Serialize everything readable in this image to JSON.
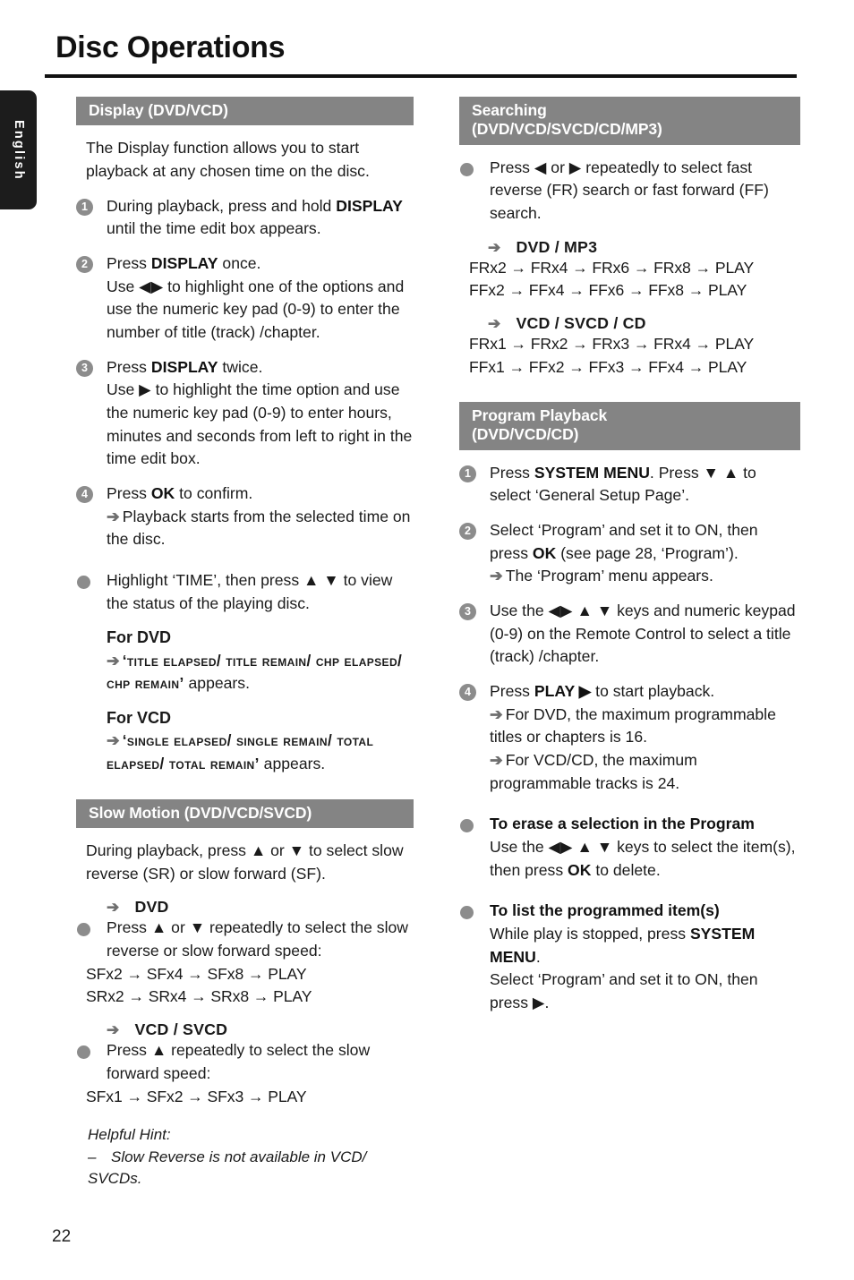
{
  "page": {
    "title": "Disc Operations",
    "number": "22",
    "language_tab": "English",
    "bar_color": "#848484",
    "badge_color": "#8c8c8c"
  },
  "left_column": {
    "display_section": {
      "heading": "Display (DVD/VCD)",
      "intro": "The Display function allows you to start playback at any chosen time on the disc.",
      "steps": [
        {
          "num": "1",
          "line1_pre": "During playback, press and hold ",
          "line1_bold": "DISPLAY",
          "line1_post": " until the time edit box appears."
        },
        {
          "num": "2",
          "line1_pre": "Press ",
          "line1_bold": "DISPLAY",
          "line1_post": " once.",
          "line2": "Use ◀▶ to highlight one of the options and use the numeric key pad (0-9) to enter the number of title (track) /chapter."
        },
        {
          "num": "3",
          "line1_pre": "Press ",
          "line1_bold": "DISPLAY",
          "line1_post": " twice.",
          "line2": "Use ▶ to highlight the time option and use the numeric key pad (0-9) to enter hours, minutes and seconds from left to right in the time edit box."
        },
        {
          "num": "4",
          "line1_pre": "Press ",
          "line1_bold": "OK",
          "line1_post": " to confirm.",
          "arrow_line": "Playback starts from the selected time on the disc."
        }
      ],
      "time_bullet": {
        "text": "Highlight ‘TIME’, then press ▲ ▼ to view the status of the playing disc.",
        "for_dvd_label": "For DVD",
        "for_dvd_value": "‘title elapsed/ title remain/ chp elapsed/ chp remain’",
        "for_dvd_suffix": " appears.",
        "for_vcd_label": "For VCD",
        "for_vcd_value": "‘single elapsed/ single remain/ total elapsed/ total remain’",
        "for_vcd_suffix": " appears."
      }
    },
    "slow_motion_section": {
      "heading": "Slow Motion (DVD/VCD/SVCD)",
      "intro": "During playback, press ▲ or ▼ to select slow reverse (SR) or slow forward (SF).",
      "dvd_subhead": "DVD",
      "dvd_bullet": "Press ▲ or ▼ repeatedly to select the slow reverse or slow forward speed:",
      "dvd_seq1": "SFx2 → SFx4 → SFx8 → PLAY",
      "dvd_seq2": "SRx2 → SRx4 → SRx8 → PLAY",
      "vcd_subhead": "VCD / SVCD",
      "vcd_bullet": "Press ▲ repeatedly to select the slow forward speed:",
      "vcd_seq1": "SFx1 → SFx2 → SFx3 → PLAY",
      "hint_title": "Helpful Hint:",
      "hint_text": "Slow Reverse is not available in VCD/ SVCDs."
    }
  },
  "right_column": {
    "searching_section": {
      "heading_line1": "Searching",
      "heading_line2": "(DVD/VCD/SVCD/CD/MP3)",
      "bullet": "Press ◀ or ▶ repeatedly to select fast reverse (FR) search or fast forward (FF) search.",
      "dvd_subhead": "DVD / MP3",
      "dvd_seq1": "FRx2 → FRx4 → FRx6 → FRx8 → PLAY",
      "dvd_seq2": "FFx2 → FFx4 → FFx6 → FFx8 → PLAY",
      "vcd_subhead": "VCD / SVCD / CD",
      "vcd_seq1": "FRx1 → FRx2 → FRx3 → FRx4 → PLAY",
      "vcd_seq2": "FFx1 → FFx2 → FFx3 → FFx4 → PLAY"
    },
    "program_section": {
      "heading_line1": "Program Playback",
      "heading_line2": "(DVD/VCD/CD)",
      "steps": [
        {
          "num": "1",
          "pre": "Press ",
          "bold": "SYSTEM MENU",
          "post": ". Press ▼ ▲ to select ‘General Setup Page’."
        },
        {
          "num": "2",
          "pre": "Select ‘Program’ and set it to ON, then press ",
          "bold": "OK",
          "post": " (see page 28, ‘Program’).",
          "arrow_line": "The ‘Program’ menu appears."
        },
        {
          "num": "3",
          "pre": "Use the ◀▶ ▲ ▼ keys and numeric keypad (0-9) on the Remote Control to select a title (track) /chapter.",
          "bold": "",
          "post": ""
        },
        {
          "num": "4",
          "pre": "Press ",
          "bold": "PLAY ▶",
          "post": " to start playback.",
          "arrow_line1": "For DVD, the maximum programmable titles or chapters is 16.",
          "arrow_line2": "For VCD/CD, the maximum programmable tracks is 24."
        }
      ],
      "erase_bullet": {
        "title": "To erase a selection in the Program",
        "body_pre": "Use the ◀▶ ▲ ▼ keys to select the item(s), then press ",
        "body_bold": "OK",
        "body_post": " to delete."
      },
      "list_bullet": {
        "title": "To list the programmed item(s)",
        "line1_pre": "While play is stopped, press ",
        "line1_bold": "SYSTEM MENU",
        "line1_post": ".",
        "line2": "Select ‘Program’ and set it to ON, then press ▶."
      }
    }
  }
}
